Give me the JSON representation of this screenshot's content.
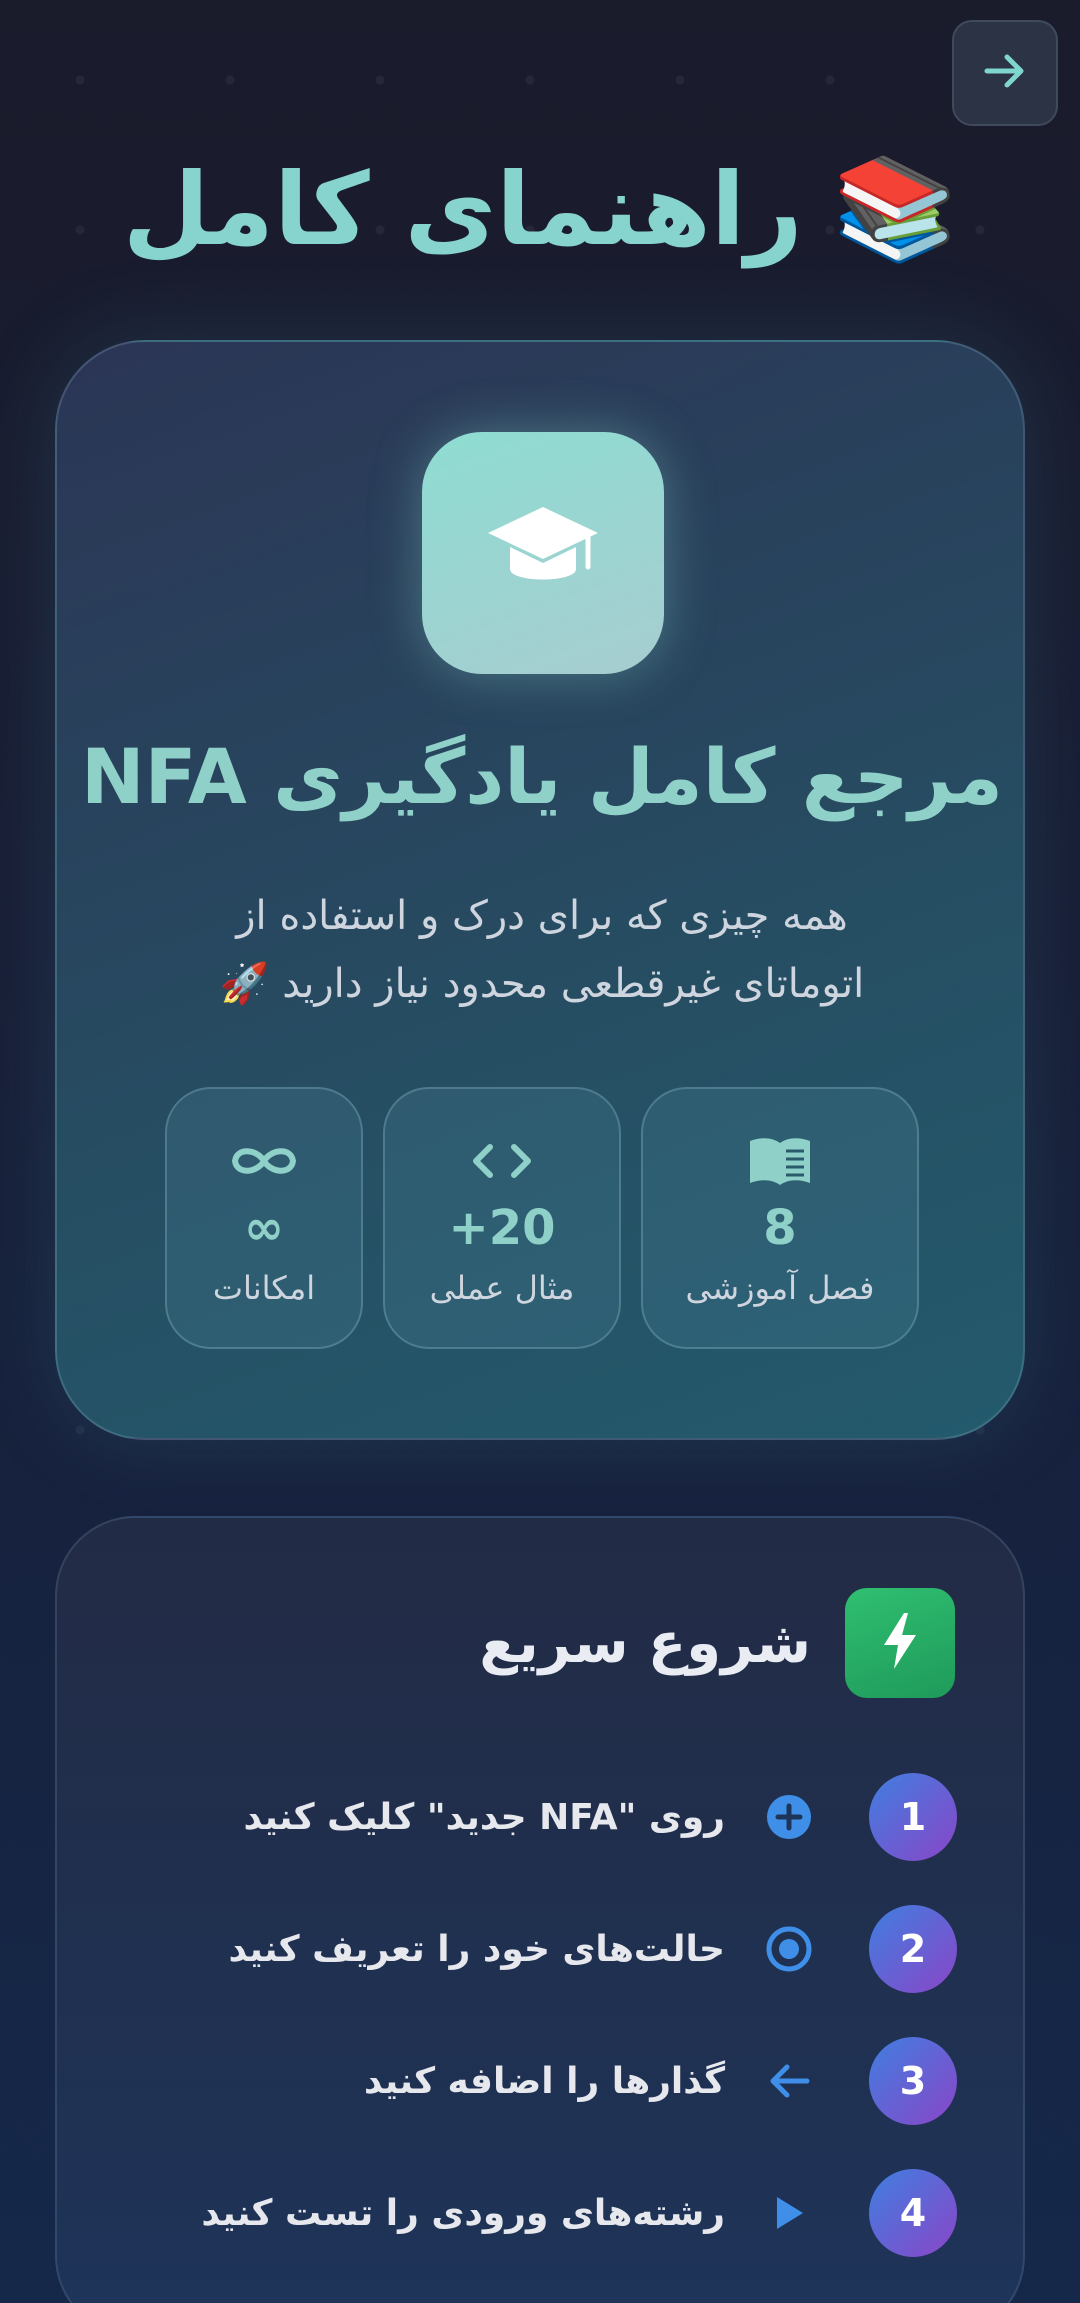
{
  "header": {
    "title": "راهنمای کامل",
    "title_emoji": "📚",
    "back_icon": "arrow-right-icon"
  },
  "hero": {
    "icon": "graduation-cap-icon",
    "title": "مرجع کامل یادگیری NFA",
    "subtitle_line1": "همه چیزی که برای درک و استفاده از",
    "subtitle_line2": "اتوماتای غیرقطعی محدود نیاز دارید 🚀",
    "stats": [
      {
        "icon": "book-open-icon",
        "value": "8",
        "label": "فصل آموزشی"
      },
      {
        "icon": "code-icon",
        "value": "+20",
        "label": "مثال عملی"
      },
      {
        "icon": "infinity-icon",
        "value": "∞",
        "label": "امکانات"
      }
    ]
  },
  "quick_start": {
    "icon": "bolt-icon",
    "title": "شروع سریع",
    "steps": [
      {
        "number": "1",
        "icon": "plus-circle-icon",
        "text": "روی \"NFA جدید\" کلیک کنید"
      },
      {
        "number": "2",
        "icon": "dot-circle-icon",
        "text": "حالت‌های خود را تعریف کنید"
      },
      {
        "number": "3",
        "icon": "arrow-left-icon",
        "text": "گذارها را اضافه کنید"
      },
      {
        "number": "4",
        "icon": "play-icon",
        "text": "رشته‌های ورودی را تست کنید"
      }
    ]
  },
  "colors": {
    "accent_teal": "#87d3cd",
    "step_blue": "#3f8fe8",
    "bolt_green": "#2fbf71"
  }
}
